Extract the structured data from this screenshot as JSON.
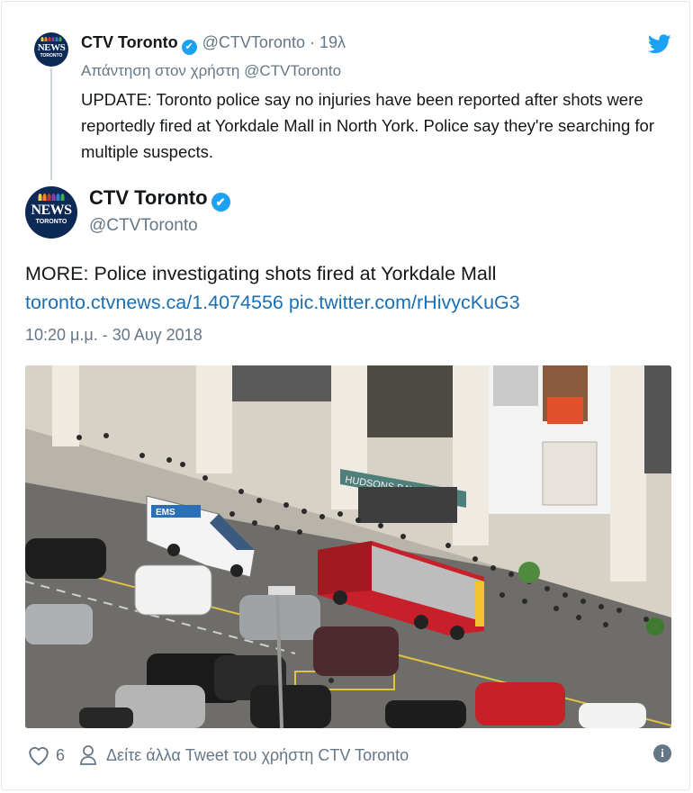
{
  "reply_tweet": {
    "avatar_text": "NEWS",
    "avatar_subtext": "TORONTO",
    "name": "CTV Toronto",
    "verified_mark": "✔",
    "handle": "@CTVToronto",
    "separator": "·",
    "time_ago": "19λ",
    "replying_to": "Απάντηση στον χρήστη @CTVToronto",
    "text": "UPDATE: Toronto police say no injuries have been reported after shots were reportedly fired at Yorkdale Mall in North York. Police say they're searching for multiple suspects."
  },
  "main_tweet": {
    "avatar_text": "NEWS",
    "avatar_subtext": "TORONTO",
    "name": "CTV Toronto",
    "verified_mark": "✔",
    "handle": "@CTVToronto",
    "text": "MORE:  Police investigating shots fired at Yorkdale Mall",
    "link1": "toronto.ctvnews.ca/1.4074556",
    "link2": "pic.twitter.com/rHivycKuG3",
    "timestamp": "10:20 μ.μ. - 30 Αυγ 2018",
    "photo": {
      "store_sign": "HUDSONS BAY",
      "ambulance_label": "EMS"
    }
  },
  "footer": {
    "likes": "6",
    "see_more": "Δείτε άλλα Tweet του χρήστη CTV Toronto",
    "info": "i"
  },
  "colors": {
    "twitter_blue": "#1da1f2",
    "link_blue": "#1b6fb3",
    "muted_gray": "#657786",
    "ctv_navy": "#0d2a57",
    "fire_truck_red": "#c8202a"
  },
  "icons": [
    "twitter-bird-icon",
    "verified-badge-icon",
    "heart-icon",
    "person-icon",
    "info-icon"
  ]
}
